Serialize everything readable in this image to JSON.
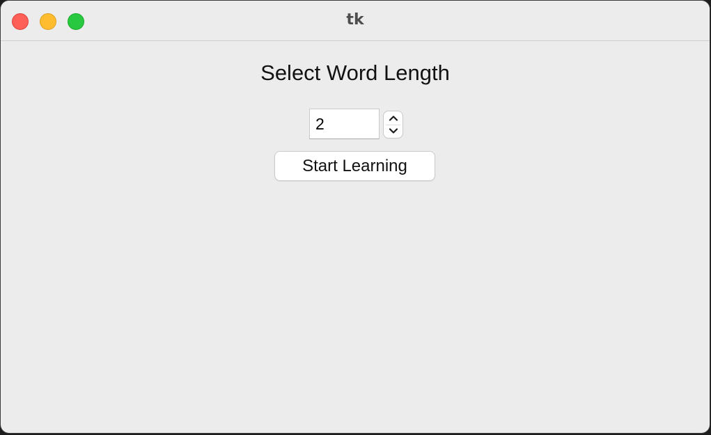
{
  "window": {
    "title": "tk",
    "controls": {
      "close_color": "#fe5f57",
      "minimize_color": "#febc2e",
      "zoom_color": "#28c840"
    }
  },
  "main": {
    "heading": "Select Word Length",
    "word_length_spinbox": {
      "value": "2"
    },
    "start_button_label": "Start Learning"
  }
}
